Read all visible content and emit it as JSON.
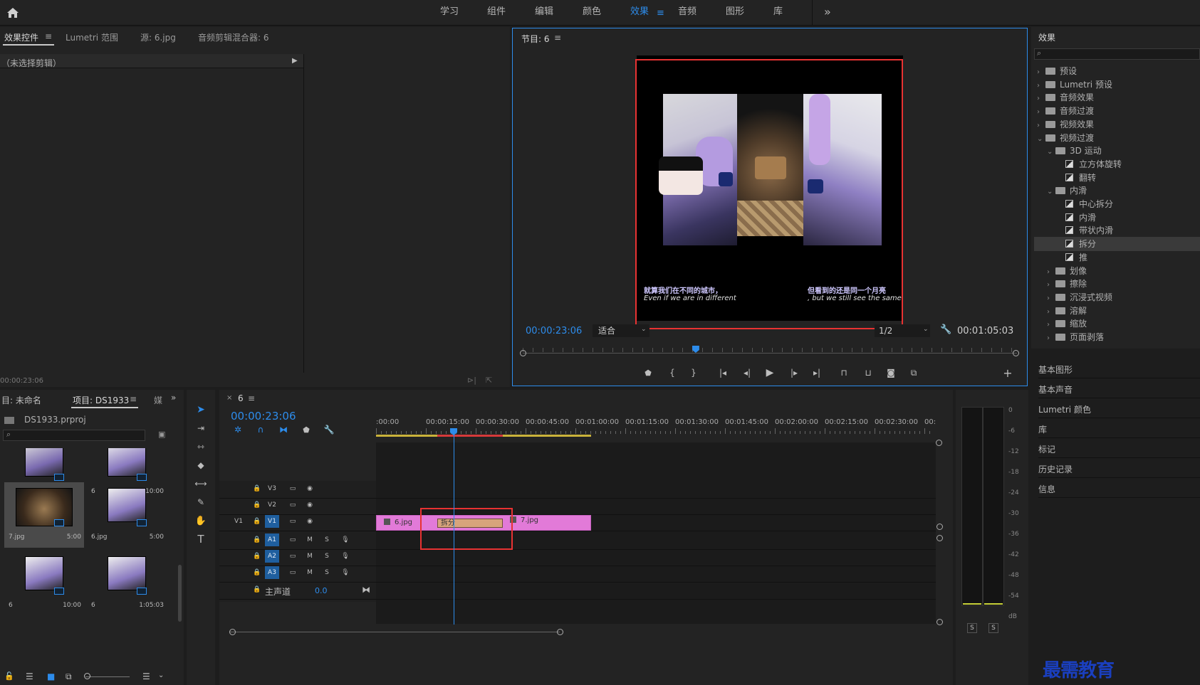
{
  "workspaces": [
    "学习",
    "组件",
    "编辑",
    "颜色",
    "效果",
    "音频",
    "图形",
    "库"
  ],
  "active_workspace": "效果",
  "more": "»",
  "effect_controls": {
    "tabs": [
      "效果控件",
      "Lumetri 范围",
      "源: 6.jpg",
      "音频剪辑混合器: 6"
    ],
    "no_clip": "（未选择剪辑）",
    "timecode": "00:00:23:06"
  },
  "program": {
    "title": "节目: 6",
    "timecode": "00:00:23:06",
    "fit": "适合",
    "quality": "1/2",
    "duration": "00:01:05:03",
    "subtitle_cn_left": "就算我们在不同的城市，",
    "subtitle_en_left": "Even if we are in different citie",
    "subtitle_cn_right": "但看到的还是同一个月亮",
    "subtitle_en_right": ", but we still see the same moo",
    "playhead_fraction": 0.35
  },
  "effects_panel": {
    "title": "效果",
    "search_placeholder": "",
    "tree": [
      {
        "label": "预设",
        "type": "folder",
        "depth": 0,
        "open": false
      },
      {
        "label": "Lumetri 预设",
        "type": "folder",
        "depth": 0,
        "open": false
      },
      {
        "label": "音频效果",
        "type": "folder",
        "depth": 0,
        "open": false
      },
      {
        "label": "音频过渡",
        "type": "folder",
        "depth": 0,
        "open": false
      },
      {
        "label": "视频效果",
        "type": "folder",
        "depth": 0,
        "open": false
      },
      {
        "label": "视频过渡",
        "type": "folder",
        "depth": 0,
        "open": true
      },
      {
        "label": "3D 运动",
        "type": "folder",
        "depth": 1,
        "open": true
      },
      {
        "label": "立方体旋转",
        "type": "fx",
        "depth": 2
      },
      {
        "label": "翻转",
        "type": "fx",
        "depth": 2
      },
      {
        "label": "内滑",
        "type": "folder",
        "depth": 1,
        "open": true
      },
      {
        "label": "中心拆分",
        "type": "fx",
        "depth": 2
      },
      {
        "label": "内滑",
        "type": "fx",
        "depth": 2
      },
      {
        "label": "带状内滑",
        "type": "fx",
        "depth": 2
      },
      {
        "label": "拆分",
        "type": "fx",
        "depth": 2,
        "selected": true
      },
      {
        "label": "推",
        "type": "fx",
        "depth": 2
      },
      {
        "label": "划像",
        "type": "folder",
        "depth": 1,
        "open": false
      },
      {
        "label": "擦除",
        "type": "folder",
        "depth": 1,
        "open": false
      },
      {
        "label": "沉浸式视频",
        "type": "folder",
        "depth": 1,
        "open": false
      },
      {
        "label": "溶解",
        "type": "folder",
        "depth": 1,
        "open": false
      },
      {
        "label": "缩放",
        "type": "folder",
        "depth": 1,
        "open": false
      },
      {
        "label": "页面剥落",
        "type": "folder",
        "depth": 1,
        "open": false
      }
    ],
    "sections": [
      "基本图形",
      "基本声音",
      "Lumetri 颜色",
      "库",
      "标记",
      "历史记录",
      "信息"
    ]
  },
  "project": {
    "tabs": [
      "目: 未命名",
      "项目: DS1933",
      "媒"
    ],
    "file": "DS1933.prproj",
    "items": [
      {
        "name": "6.jpg",
        "dur": "5:00"
      },
      {
        "name": "6",
        "dur": "10:00"
      },
      {
        "name": "7.jpg",
        "dur": "5:00"
      },
      {
        "name": "6.jpg",
        "dur": "5:00"
      },
      {
        "name": "6",
        "dur": "10:00"
      },
      {
        "name": "6",
        "dur": "1:05:03"
      }
    ]
  },
  "timeline": {
    "tab": "6",
    "timecode": "00:00:23:06",
    "ruler": [
      ":00:00",
      "00:00:15:00",
      "00:00:30:00",
      "00:00:45:00",
      "00:01:00:00",
      "00:01:15:00",
      "00:01:30:00",
      "00:01:45:00",
      "00:02:00:00",
      "00:02:15:00",
      "00:02:30:00",
      "00:02:45:"
    ],
    "tracks": {
      "v3": "V3",
      "v2": "V2",
      "v1": "V1",
      "v1_src": "V1",
      "a1": "A1",
      "a2": "A2",
      "a3": "A3",
      "m": "M",
      "s": "S",
      "master": "主声道",
      "master_val": "0.0"
    },
    "clips": {
      "clip1": "6.jpg",
      "transition": "拆分",
      "clip2": "7.jpg"
    }
  },
  "meter": {
    "scale": [
      "0",
      "-6",
      "-12",
      "-18",
      "-24",
      "-30",
      "-36",
      "-42",
      "-48",
      "-54",
      "dB"
    ],
    "solo_l": "S",
    "solo_r": "S"
  },
  "watermark": "最需教育",
  "colors": {
    "accent": "#2d8ceb",
    "clip": "#e27ad8",
    "transition": "#d7a47c",
    "highlight": "#e83232"
  }
}
